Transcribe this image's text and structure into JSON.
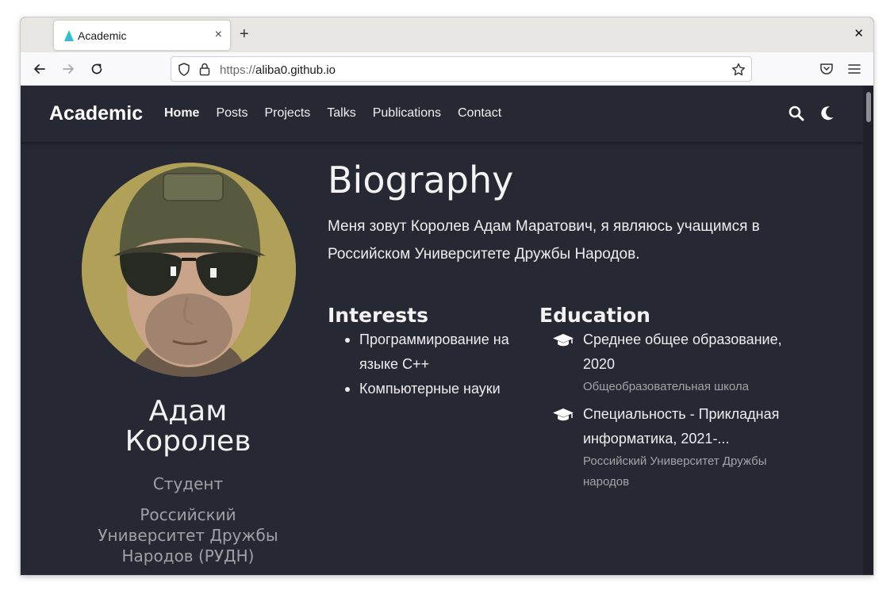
{
  "browser": {
    "tab_title": "Academic",
    "new_tab": "+",
    "tab_close": "×",
    "window_close": "✕",
    "url_scheme": "https://",
    "url_host": "aliba0.github.io"
  },
  "site": {
    "brand": "Academic",
    "nav": [
      {
        "label": "Home",
        "active": true
      },
      {
        "label": "Posts"
      },
      {
        "label": "Projects"
      },
      {
        "label": "Talks"
      },
      {
        "label": "Publications"
      },
      {
        "label": "Contact"
      }
    ]
  },
  "profile": {
    "name": "Адам Королев",
    "role": "Студент",
    "organization": "Российский Университет Дружбы Народов (РУДН)"
  },
  "biography": {
    "title": "Biography",
    "text": "Меня зовут Королев Адам Маратович, я являюсь учащимся в Российском Университете Дружбы Народов."
  },
  "interests": {
    "title": "Interests",
    "items": [
      "Программирование на языке C++",
      "Компьютерные науки"
    ]
  },
  "education": {
    "title": "Education",
    "items": [
      {
        "course": "Среднее общее образование, 2020",
        "institution": "Общеобразовательная школа"
      },
      {
        "course": "Специальность - Прикладная информатика, 2021-...",
        "institution": "Российский Университет Дружбы народов"
      }
    ]
  },
  "colors": {
    "page_background": "#262833",
    "accent_favicon": "#1fcbb0"
  },
  "icons": [
    "back-icon",
    "forward-icon",
    "reload-icon",
    "shield-icon",
    "lock-icon",
    "star-icon",
    "pocket-icon",
    "menu-icon",
    "search-icon",
    "moon-icon",
    "graduation-cap-icon"
  ]
}
